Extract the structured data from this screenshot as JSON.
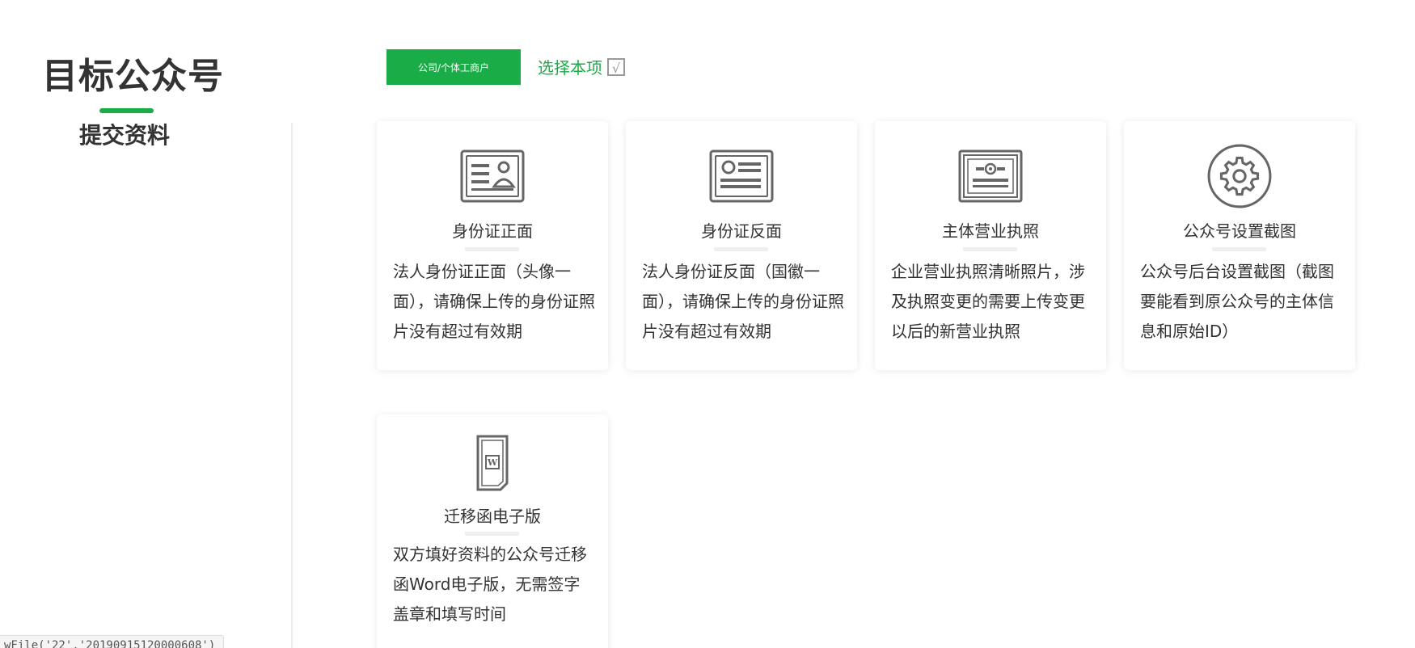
{
  "header": {
    "page_title": "目标公众号",
    "active_tab": "提交资料"
  },
  "options": {
    "type_button_label": "公司/个体工商户",
    "select_label": "选择本项",
    "check_mark": "√"
  },
  "cards": [
    {
      "icon": "id-card-front-icon",
      "title": "身份证正面",
      "desc": "法人身份证正面（头像一面），请确保上传的身份证照片没有超过有效期"
    },
    {
      "icon": "id-card-back-icon",
      "title": "身份证反面",
      "desc": "法人身份证反面（国徽一面），请确保上传的身份证照片没有超过有效期"
    },
    {
      "icon": "business-license-icon",
      "title": "主体营业执照",
      "desc": "企业营业执照清晰照片，涉及执照变更的需要上传变更以后的新营业执照"
    },
    {
      "icon": "gear-icon",
      "title": "公众号设置截图",
      "desc": "公众号后台设置截图（截图要能看到原公众号的主体信息和原始ID）"
    },
    {
      "icon": "word-document-icon",
      "title": "迁移函电子版",
      "desc": "双方填好资料的公众号迁移函Word电子版，无需签字盖章和填写时间"
    }
  ],
  "status_bar": {
    "text": "wFile('22','20190915120000608')"
  },
  "colors": {
    "accent": "#1aad47",
    "text": "#333333",
    "icon": "#666666"
  }
}
